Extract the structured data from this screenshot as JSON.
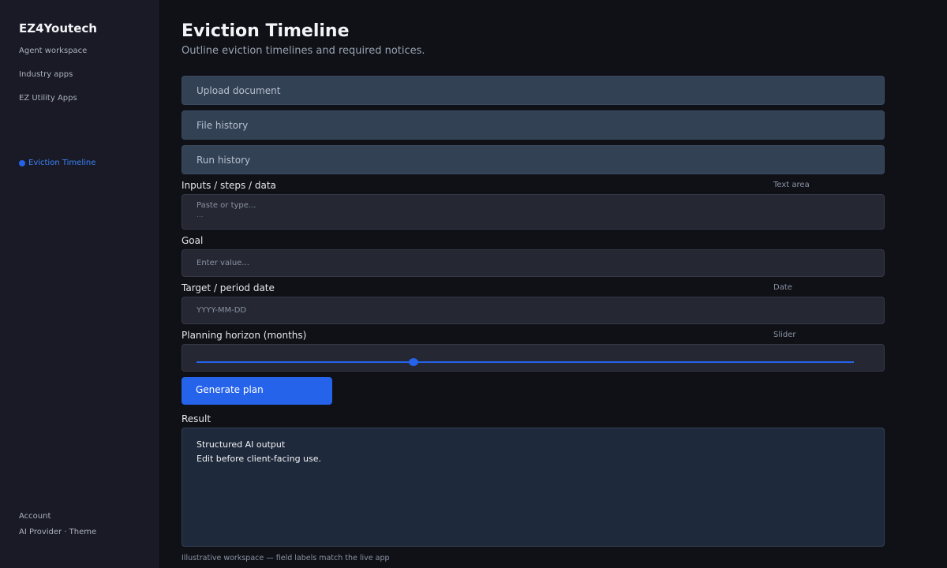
{
  "sidebar": {
    "brand": "EZ4Youtech",
    "links": [
      "Agent workspace",
      "Industry apps",
      "EZ Utility Apps"
    ],
    "active_item": "Eviction Timeline",
    "bottom_links": [
      "Account",
      "AI Provider · Theme"
    ]
  },
  "header": {
    "title": "Eviction Timeline",
    "subtitle": "Outline eviction timelines and required notices."
  },
  "sections": {
    "upload": "Upload document",
    "file_history": "File history",
    "run_history": "Run history"
  },
  "form": {
    "inputs": {
      "label": "Inputs / steps / data",
      "hint": "Text area",
      "placeholder": "Paste or type...",
      "placeholder_line2": "..."
    },
    "goal": {
      "label": "Goal",
      "placeholder": "Enter value..."
    },
    "target_date": {
      "label": "Target / period date",
      "hint": "Date",
      "placeholder": "YYYY-MM-DD"
    },
    "horizon": {
      "label": "Planning horizon (months)",
      "hint": "Slider",
      "value_fraction": 0.33
    },
    "submit_label": "Generate plan"
  },
  "result": {
    "label": "Result",
    "line1": "Structured AI output",
    "line2": "Edit before client-facing use."
  },
  "footer": "Illustrative workspace — field labels match the live app",
  "colors": {
    "accent": "#2563eb",
    "background": "#0f1117",
    "sidebar": "#191a26"
  }
}
